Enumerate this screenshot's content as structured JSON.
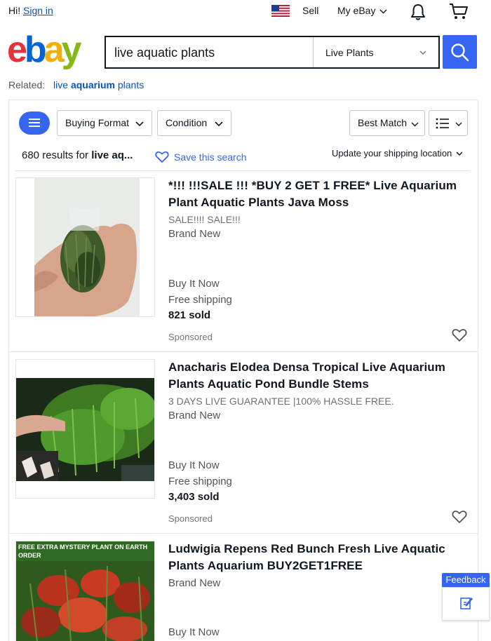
{
  "topbar": {
    "greeting": "Hi!",
    "sign_in": "Sign in",
    "flag_icon": "us-flag-icon",
    "sell": "Sell",
    "my_ebay": "My eBay",
    "bell_icon": "bell-icon",
    "cart_icon": "cart-icon"
  },
  "search": {
    "query": "live aquatic plants",
    "category": "Live Plants",
    "button_icon": "search-icon"
  },
  "related": {
    "label": "Related:",
    "link_pre": "live",
    "link_bold": "aquarium",
    "link_post": "plants"
  },
  "filters": {
    "buying_format": "Buying Format",
    "condition": "Condition",
    "sort": "Best Match"
  },
  "results": {
    "count": "680",
    "text": "results for",
    "query_short": "live aq..."
  },
  "save_search": "Save this search",
  "shipping_location": "Update your shipping location",
  "items": [
    {
      "title": "*!!! !!!SALE !!! *BUY 2 GET 1 FREE* Live Aquarium Plant Aquatic Plants Java Moss",
      "subtitle": "SALE!!!! SALE!!!",
      "condition": "Brand New",
      "format": "Buy It Now",
      "shipping": "Free shipping",
      "sold": "821 sold",
      "sponsored": "Sponsored"
    },
    {
      "title": "Anacharis Elodea Densa Tropical Live Aquarium Plants Aquatic Pond Bundle Stems",
      "subtitle": "3 DAYS LIVE GUARANTEE |100% HASSLE FREE.",
      "condition": "Brand New",
      "format": "Buy It Now",
      "shipping": "Free shipping",
      "sold": "3,403 sold",
      "sponsored": "Sponsored"
    },
    {
      "title": "Ludwigia Repens Red Bunch Fresh Live Aquatic Plants Aquarium BUY2GET1FREE",
      "condition": "Brand New",
      "format": "Buy It Now",
      "image_banner_1": "FREE EXTRA MYSTERY PLANT ON EARTH",
      "image_banner_2": "ORDER"
    }
  ],
  "feedback": "Feedback",
  "colors": {
    "accent": "#3665f3",
    "link": "#0654ba"
  }
}
